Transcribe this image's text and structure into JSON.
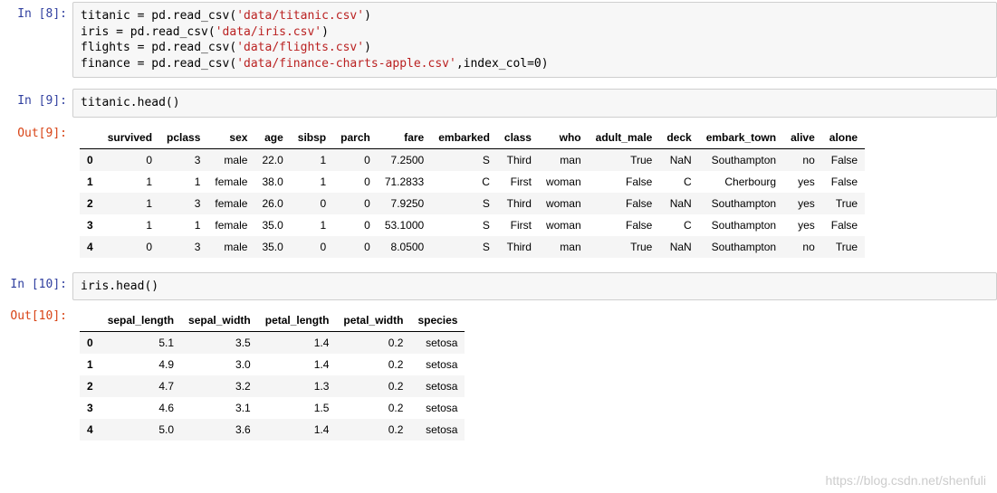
{
  "cells": {
    "c8": {
      "in_label": "In  [8]:",
      "code_tokens": [
        {
          "t": "titanic = pd.read_csv("
        },
        {
          "t": "'data/titanic.csv'",
          "cls": "str"
        },
        {
          "t": ")\n"
        },
        {
          "t": "iris = pd.read_csv("
        },
        {
          "t": "'data/iris.csv'",
          "cls": "str"
        },
        {
          "t": ")\n"
        },
        {
          "t": "flights = pd.read_csv("
        },
        {
          "t": "'data/flights.csv'",
          "cls": "str"
        },
        {
          "t": ")\n"
        },
        {
          "t": "finance = pd.read_csv("
        },
        {
          "t": "'data/finance-charts-apple.csv'",
          "cls": "str"
        },
        {
          "t": ",index_col=0)"
        }
      ]
    },
    "c9": {
      "in_label": "In  [9]:",
      "out_label": "Out[9]:",
      "code_tokens": [
        {
          "t": "titanic.head()"
        }
      ],
      "table": {
        "columns": [
          "survived",
          "pclass",
          "sex",
          "age",
          "sibsp",
          "parch",
          "fare",
          "embarked",
          "class",
          "who",
          "adult_male",
          "deck",
          "embark_town",
          "alive",
          "alone"
        ],
        "index": [
          "0",
          "1",
          "2",
          "3",
          "4"
        ],
        "rows": [
          [
            "0",
            "3",
            "male",
            "22.0",
            "1",
            "0",
            "7.2500",
            "S",
            "Third",
            "man",
            "True",
            "NaN",
            "Southampton",
            "no",
            "False"
          ],
          [
            "1",
            "1",
            "female",
            "38.0",
            "1",
            "0",
            "71.2833",
            "C",
            "First",
            "woman",
            "False",
            "C",
            "Cherbourg",
            "yes",
            "False"
          ],
          [
            "1",
            "3",
            "female",
            "26.0",
            "0",
            "0",
            "7.9250",
            "S",
            "Third",
            "woman",
            "False",
            "NaN",
            "Southampton",
            "yes",
            "True"
          ],
          [
            "1",
            "1",
            "female",
            "35.0",
            "1",
            "0",
            "53.1000",
            "S",
            "First",
            "woman",
            "False",
            "C",
            "Southampton",
            "yes",
            "False"
          ],
          [
            "0",
            "3",
            "male",
            "35.0",
            "0",
            "0",
            "8.0500",
            "S",
            "Third",
            "man",
            "True",
            "NaN",
            "Southampton",
            "no",
            "True"
          ]
        ]
      }
    },
    "c10": {
      "in_label": "In  [10]:",
      "out_label": "Out[10]:",
      "code_tokens": [
        {
          "t": "iris.head()"
        }
      ],
      "table": {
        "columns": [
          "sepal_length",
          "sepal_width",
          "petal_length",
          "petal_width",
          "species"
        ],
        "index": [
          "0",
          "1",
          "2",
          "3",
          "4"
        ],
        "rows": [
          [
            "5.1",
            "3.5",
            "1.4",
            "0.2",
            "setosa"
          ],
          [
            "4.9",
            "3.0",
            "1.4",
            "0.2",
            "setosa"
          ],
          [
            "4.7",
            "3.2",
            "1.3",
            "0.2",
            "setosa"
          ],
          [
            "4.6",
            "3.1",
            "1.5",
            "0.2",
            "setosa"
          ],
          [
            "5.0",
            "3.6",
            "1.4",
            "0.2",
            "setosa"
          ]
        ]
      }
    }
  },
  "watermark": "https://blog.csdn.net/shenfuli"
}
